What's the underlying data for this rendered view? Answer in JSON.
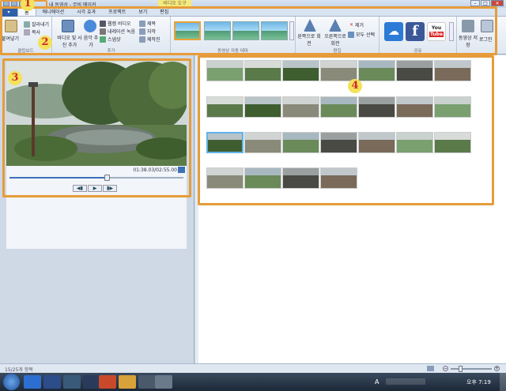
{
  "window": {
    "title": "내 동영상 - 무비 메이커",
    "context_tab": "비디오 도구"
  },
  "tabs": [
    {
      "label": "홈",
      "active": true
    },
    {
      "label": "애니메이션"
    },
    {
      "label": "시각 효과"
    },
    {
      "label": "프로젝트"
    },
    {
      "label": "보기"
    },
    {
      "label": "편집"
    }
  ],
  "ribbon": {
    "clipboard": {
      "paste": "붙여넣기",
      "cut": "잘라내기",
      "copy": "복사",
      "label": "클립보드"
    },
    "add": {
      "add_media": "비디오 및 사진 추가",
      "add_music": "음악 추가",
      "webcam": "웹캠 비디오",
      "narration": "내레이션 녹음",
      "snapshot": "스냅샷",
      "title": "제목",
      "caption": "자막",
      "credits": "제작진",
      "label": "추가"
    },
    "themes": {
      "label": "동영상 자동 테마"
    },
    "edit": {
      "rotate_left": "왼쪽으로 회전",
      "rotate_right": "오른쪽으로 회전",
      "remove": "제거",
      "select_all": "모두 선택",
      "label": "편집"
    },
    "share": {
      "label": "공유",
      "youtube_line1": "You",
      "youtube_line2": "Tube"
    },
    "save": {
      "save_movie": "동영상 저장",
      "signin": "로그인"
    }
  },
  "player": {
    "time": "01:38.03/02:55.00",
    "progress": 0.56
  },
  "status": {
    "items": "15/25개 항목"
  },
  "taskbar": {
    "time": "오후 7:19",
    "lang": "A"
  },
  "annotations": [
    "1",
    "2",
    "3",
    "4"
  ],
  "colors": {
    "accent": "#e69c3a",
    "badge": "#f3e25a",
    "badge_text": "#d02727"
  }
}
